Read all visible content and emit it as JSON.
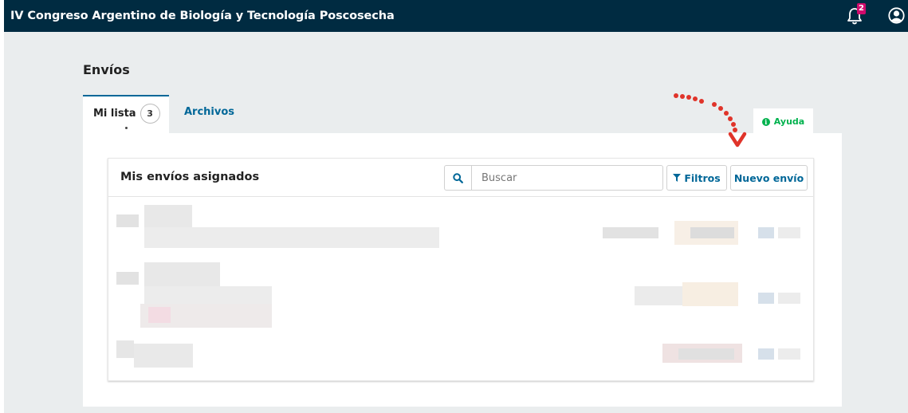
{
  "header": {
    "site_title": "IV Congreso Argentino de Biología y Tecnología Poscosecha",
    "notification_count": "2",
    "icons": {
      "notifications": "bell-icon",
      "user": "user-circle-icon"
    }
  },
  "page": {
    "title": "Envíos",
    "tabs": [
      {
        "label": "Mi lista",
        "count": "3",
        "active": true
      },
      {
        "label": "Archivos",
        "active": false
      }
    ],
    "help_label": "Ayuda"
  },
  "submissions": {
    "title": "Mis envíos asignados",
    "search": {
      "placeholder": "Buscar",
      "value": ""
    },
    "filters_label": "Filtros",
    "new_label": "Nuevo envío"
  },
  "colors": {
    "header_bg": "#002b41",
    "link": "#006798",
    "help": "#00b24e",
    "badge": "#d00a6c",
    "annotation": "#e0342a"
  }
}
